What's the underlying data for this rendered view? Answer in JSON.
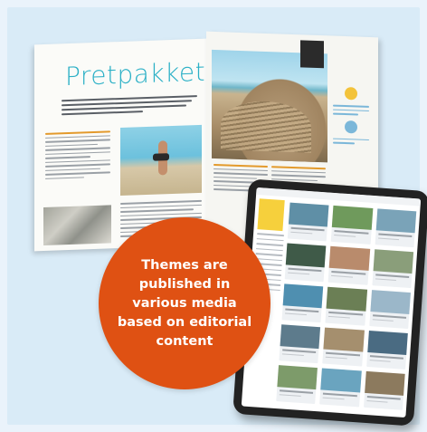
{
  "magazine": {
    "title": "Pretpakket"
  },
  "callout": {
    "text": "Themes are published in various media based on editorial content"
  },
  "colors": {
    "background": "#d9ebf7",
    "bubble": "#df5113",
    "title_accent": "#2bb0c6",
    "tablet_accent": "#f6d03c"
  }
}
